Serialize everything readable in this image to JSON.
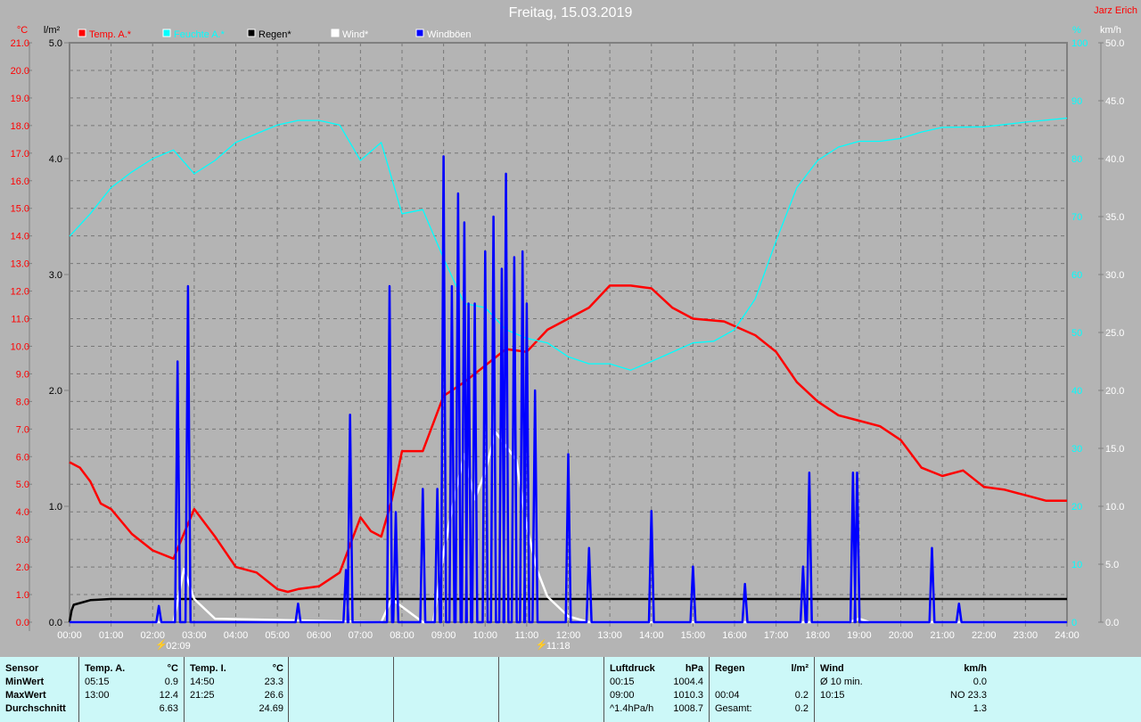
{
  "header": {
    "title": "Freitag, 15.03.2019",
    "author": "Jarz Erich"
  },
  "legend": [
    {
      "label": "Temp. A.*",
      "color": "#ff0000"
    },
    {
      "label": "Feuchte A.*",
      "color": "#00ffff"
    },
    {
      "label": "Regen*",
      "color": "#000000"
    },
    {
      "label": "Wind*",
      "color": "#ffffff"
    },
    {
      "label": "Windböen",
      "color": "#0000ff"
    }
  ],
  "markers": [
    {
      "time": "02:09",
      "hour": 2.15
    },
    {
      "time": "11:18",
      "hour": 11.3
    }
  ],
  "chart_data": {
    "type": "line",
    "title": "Freitag, 15.03.2019",
    "x_ticks": [
      "00:00",
      "01:00",
      "02:00",
      "03:00",
      "04:00",
      "05:00",
      "06:00",
      "07:00",
      "08:00",
      "09:00",
      "10:00",
      "11:00",
      "12:00",
      "13:00",
      "14:00",
      "15:00",
      "16:00",
      "17:00",
      "18:00",
      "19:00",
      "20:00",
      "21:00",
      "22:00",
      "23:00",
      "24:00"
    ],
    "xlim": [
      0,
      24
    ],
    "axes": {
      "temp": {
        "unit": "°C",
        "ylim": [
          0,
          21
        ],
        "step": 1,
        "color": "#ff0000"
      },
      "rain": {
        "unit": "l/m²",
        "ylim": [
          0,
          5
        ],
        "step": 1,
        "color": "#000000"
      },
      "humidity": {
        "unit": "%",
        "ylim": [
          0,
          100
        ],
        "step": 10,
        "color": "#00ffff"
      },
      "wind": {
        "unit": "km/h",
        "ylim": [
          0,
          50
        ],
        "step": 5,
        "color": "#ffffff"
      }
    },
    "grid": true,
    "legend_placement": "top",
    "series": [
      {
        "name": "Temp. A.*",
        "axis": "temp",
        "color": "#ff0000",
        "points": [
          [
            0,
            5.8
          ],
          [
            0.25,
            5.6
          ],
          [
            0.5,
            5.1
          ],
          [
            0.75,
            4.3
          ],
          [
            1,
            4.1
          ],
          [
            1.5,
            3.2
          ],
          [
            2,
            2.6
          ],
          [
            2.5,
            2.3
          ],
          [
            2.75,
            3.2
          ],
          [
            3,
            4.1
          ],
          [
            3.5,
            3.1
          ],
          [
            4,
            2.0
          ],
          [
            4.5,
            1.8
          ],
          [
            5,
            1.2
          ],
          [
            5.25,
            1.1
          ],
          [
            5.5,
            1.2
          ],
          [
            6,
            1.3
          ],
          [
            6.5,
            1.8
          ],
          [
            7,
            3.8
          ],
          [
            7.25,
            3.3
          ],
          [
            7.5,
            3.1
          ],
          [
            7.75,
            4.4
          ],
          [
            8,
            6.2
          ],
          [
            8.5,
            6.2
          ],
          [
            9,
            8.2
          ],
          [
            9.5,
            8.7
          ],
          [
            10,
            9.3
          ],
          [
            10.5,
            9.9
          ],
          [
            11,
            9.8
          ],
          [
            11.5,
            10.6
          ],
          [
            12,
            11.0
          ],
          [
            12.5,
            11.4
          ],
          [
            13,
            12.2
          ],
          [
            13.5,
            12.2
          ],
          [
            14,
            12.1
          ],
          [
            14.5,
            11.4
          ],
          [
            15,
            11.0
          ],
          [
            15.75,
            10.9
          ],
          [
            16.5,
            10.4
          ],
          [
            17,
            9.8
          ],
          [
            17.5,
            8.7
          ],
          [
            18,
            8.0
          ],
          [
            18.5,
            7.5
          ],
          [
            19,
            7.3
          ],
          [
            19.5,
            7.1
          ],
          [
            20,
            6.6
          ],
          [
            20.5,
            5.6
          ],
          [
            21,
            5.3
          ],
          [
            21.5,
            5.5
          ],
          [
            22,
            4.9
          ],
          [
            22.5,
            4.8
          ],
          [
            23,
            4.6
          ],
          [
            23.5,
            4.4
          ],
          [
            24,
            4.4
          ]
        ]
      },
      {
        "name": "Feuchte A.*",
        "axis": "humidity",
        "color": "#00ffff",
        "points": [
          [
            0,
            66.6
          ],
          [
            0.5,
            70.5
          ],
          [
            1,
            75
          ],
          [
            1.5,
            77.7
          ],
          [
            2,
            80
          ],
          [
            2.5,
            81.5
          ],
          [
            3,
            77.4
          ],
          [
            3.5,
            79.7
          ],
          [
            4,
            82.8
          ],
          [
            4.5,
            84.3
          ],
          [
            5,
            85.8
          ],
          [
            5.5,
            86.6
          ],
          [
            6,
            86.6
          ],
          [
            6.5,
            85.8
          ],
          [
            7,
            79.7
          ],
          [
            7.5,
            82.8
          ],
          [
            8,
            70.5
          ],
          [
            8.5,
            71.2
          ],
          [
            9,
            62.8
          ],
          [
            9.5,
            55
          ],
          [
            10,
            54.3
          ],
          [
            10.5,
            50.5
          ],
          [
            11,
            49
          ],
          [
            11.5,
            48.2
          ],
          [
            12,
            45.8
          ],
          [
            12.5,
            44.6
          ],
          [
            13,
            44.6
          ],
          [
            13.5,
            43.5
          ],
          [
            14,
            45
          ],
          [
            14.5,
            46.6
          ],
          [
            15,
            48.2
          ],
          [
            15.5,
            48.5
          ],
          [
            16,
            50.5
          ],
          [
            16.5,
            55.8
          ],
          [
            17,
            65.8
          ],
          [
            17.5,
            75
          ],
          [
            18,
            79.7
          ],
          [
            18.5,
            82
          ],
          [
            19,
            83
          ],
          [
            19.5,
            83
          ],
          [
            20,
            83.5
          ],
          [
            20.5,
            84.6
          ],
          [
            21,
            85.4
          ],
          [
            22,
            85.5
          ],
          [
            23,
            86.3
          ],
          [
            24,
            87
          ]
        ]
      },
      {
        "name": "Regen*",
        "axis": "rain",
        "color": "#000000",
        "points": [
          [
            0,
            0
          ],
          [
            0.05,
            0.1
          ],
          [
            0.1,
            0.15
          ],
          [
            0.5,
            0.19
          ],
          [
            1,
            0.2
          ],
          [
            24,
            0.2
          ]
        ]
      },
      {
        "name": "Wind*",
        "axis": "wind",
        "color": "#ffffff",
        "points": [
          [
            0,
            0
          ],
          [
            2.5,
            0
          ],
          [
            2.75,
            4.6
          ],
          [
            3,
            2
          ],
          [
            3.5,
            0.3
          ],
          [
            7.5,
            0
          ],
          [
            7.75,
            2
          ],
          [
            8.5,
            0
          ],
          [
            8.75,
            0
          ],
          [
            9,
            6
          ],
          [
            9.25,
            10.6
          ],
          [
            9.5,
            14.5
          ],
          [
            9.75,
            10.6
          ],
          [
            10,
            13
          ],
          [
            10.25,
            16.4
          ],
          [
            10.5,
            15.2
          ],
          [
            10.75,
            14
          ],
          [
            11,
            8.3
          ],
          [
            11.25,
            4.5
          ],
          [
            11.5,
            2.2
          ],
          [
            12,
            0.5
          ],
          [
            12.5,
            0
          ],
          [
            18.75,
            0
          ],
          [
            19,
            0.3
          ],
          [
            19.25,
            0
          ],
          [
            24,
            0
          ]
        ]
      },
      {
        "name": "Windböen",
        "axis": "wind",
        "color": "#0000ff",
        "spikes": [
          [
            2.15,
            1.4
          ],
          [
            2.6,
            22.5
          ],
          [
            2.85,
            29
          ],
          [
            5.5,
            1.6
          ],
          [
            6.65,
            4.5
          ],
          [
            6.75,
            17.9
          ],
          [
            7.7,
            29
          ],
          [
            7.85,
            9.5
          ],
          [
            8.5,
            11.5
          ],
          [
            8.85,
            11.5
          ],
          [
            9.0,
            40.2
          ],
          [
            9.2,
            29
          ],
          [
            9.35,
            37
          ],
          [
            9.5,
            34.5
          ],
          [
            9.6,
            27.5
          ],
          [
            9.75,
            27.5
          ],
          [
            10.0,
            32
          ],
          [
            10.2,
            35
          ],
          [
            10.4,
            30.5
          ],
          [
            10.5,
            38.7
          ],
          [
            10.7,
            31.5
          ],
          [
            10.9,
            32
          ],
          [
            11.0,
            27.5
          ],
          [
            11.2,
            20
          ],
          [
            12.0,
            14.5
          ],
          [
            12.5,
            6.4
          ],
          [
            14.0,
            9.6
          ],
          [
            15.0,
            4.8
          ],
          [
            16.25,
            3.3
          ],
          [
            17.65,
            4.8
          ],
          [
            17.8,
            12.9
          ],
          [
            18.85,
            12.9
          ],
          [
            18.95,
            12.9
          ],
          [
            20.75,
            6.4
          ],
          [
            21.4,
            1.6
          ]
        ]
      }
    ]
  },
  "stats": {
    "sensor": {
      "title": "Sensor",
      "rows": [
        "MinWert",
        "MaxWert",
        "Durchschnitt"
      ]
    },
    "temp_a": {
      "title": "Temp. A.",
      "unit": "°C",
      "rows": [
        [
          "05:15",
          "0.9"
        ],
        [
          "13:00",
          "12.4"
        ],
        [
          "",
          "6.63"
        ]
      ]
    },
    "temp_i": {
      "title": "Temp. I.",
      "unit": "°C",
      "rows": [
        [
          "14:50",
          "23.3"
        ],
        [
          "21:25",
          "26.6"
        ],
        [
          "",
          "24.69"
        ]
      ]
    },
    "pressure": {
      "title": "Luftdruck",
      "unit": "hPa",
      "rows": [
        [
          "00:15",
          "1004.4"
        ],
        [
          "09:00",
          "1010.3"
        ],
        [
          "^1.4hPa/h",
          "1008.7"
        ]
      ]
    },
    "rain": {
      "title": "Regen",
      "unit": "l/m²",
      "rows": [
        [
          "",
          ""
        ],
        [
          "00:04",
          "0.2"
        ],
        [
          "Gesamt:",
          "0.2"
        ]
      ]
    },
    "wind": {
      "title": "Wind",
      "unit": "km/h",
      "rows": [
        [
          "Ø 10 min.",
          "0.0"
        ],
        [
          "10:15",
          "NO 23.3"
        ],
        [
          "",
          "1.3"
        ]
      ]
    }
  }
}
